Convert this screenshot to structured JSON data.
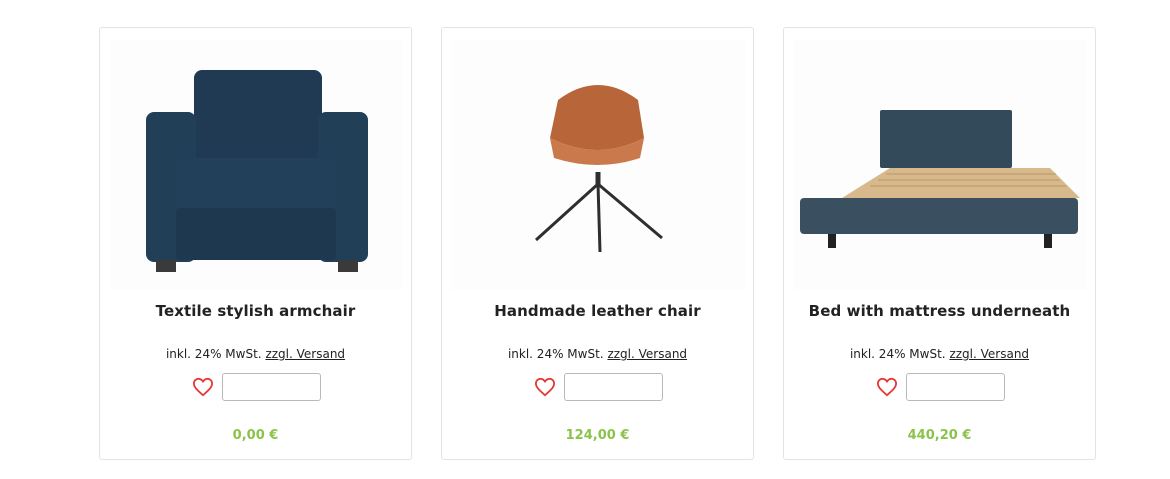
{
  "accent_color": "#8bc34a",
  "heart_color": "#e53935",
  "products": [
    {
      "title": "Textile stylish armchair",
      "tax_text": "inkl. 24% MwSt.",
      "shipping_link": "zzgl. Versand",
      "quantity": "",
      "price": "0,00 €",
      "image_icon": "armchair-image"
    },
    {
      "title": "Handmade leather chair",
      "tax_text": "inkl. 24% MwSt.",
      "shipping_link": "zzgl. Versand",
      "quantity": "",
      "price": "124,00 €",
      "image_icon": "leather-chair-image"
    },
    {
      "title": "Bed with mattress underneath",
      "tax_text": "inkl. 24% MwSt.",
      "shipping_link": "zzgl. Versand",
      "quantity": "",
      "price": "440,20 €",
      "image_icon": "bed-image"
    }
  ]
}
